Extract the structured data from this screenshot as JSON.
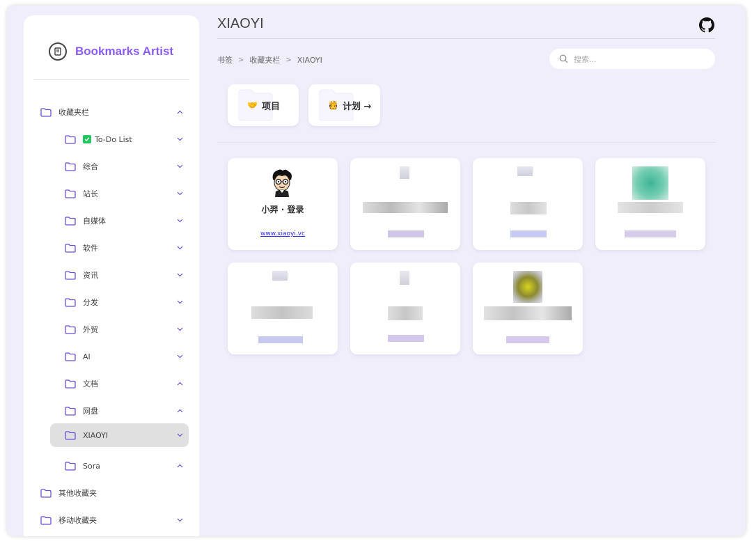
{
  "app": {
    "title": "Bookmarks Artist",
    "brand_color": "#8b5cf6"
  },
  "sidebar": {
    "root_label": "收藏夹栏",
    "items": [
      {
        "label": "To-Do List",
        "badge": "check"
      },
      {
        "label": "综合"
      },
      {
        "label": "站长"
      },
      {
        "label": "自媒体"
      },
      {
        "label": "软件"
      },
      {
        "label": "资讯"
      },
      {
        "label": "分发"
      },
      {
        "label": "外贸"
      },
      {
        "label": "AI"
      },
      {
        "label": "文档"
      },
      {
        "label": "网盘"
      },
      {
        "label": "XIAOYI",
        "active": true
      },
      {
        "label": "Sora"
      }
    ],
    "other_label": "其他收藏夹",
    "mobile_label": "移动收藏夹"
  },
  "main": {
    "title": "XIAOYI",
    "breadcrumb": [
      "书签",
      "收藏夹栏",
      "XIAOYI"
    ],
    "breadcrumb_sep": ">",
    "search_placeholder": "搜索...",
    "folders": [
      {
        "emoji": "🤝",
        "label": "项目"
      },
      {
        "emoji": "🫅",
        "label": "计划 →"
      }
    ],
    "cards": [
      {
        "name": "小羿 · 登录",
        "url": "www.xiaoyi.vc",
        "icon": "cartoon-avatar-icon"
      },
      {
        "blurred": true
      },
      {
        "blurred": true
      },
      {
        "blurred": true
      },
      {
        "blurred": true
      },
      {
        "blurred": true
      },
      {
        "blurred": true
      }
    ]
  }
}
